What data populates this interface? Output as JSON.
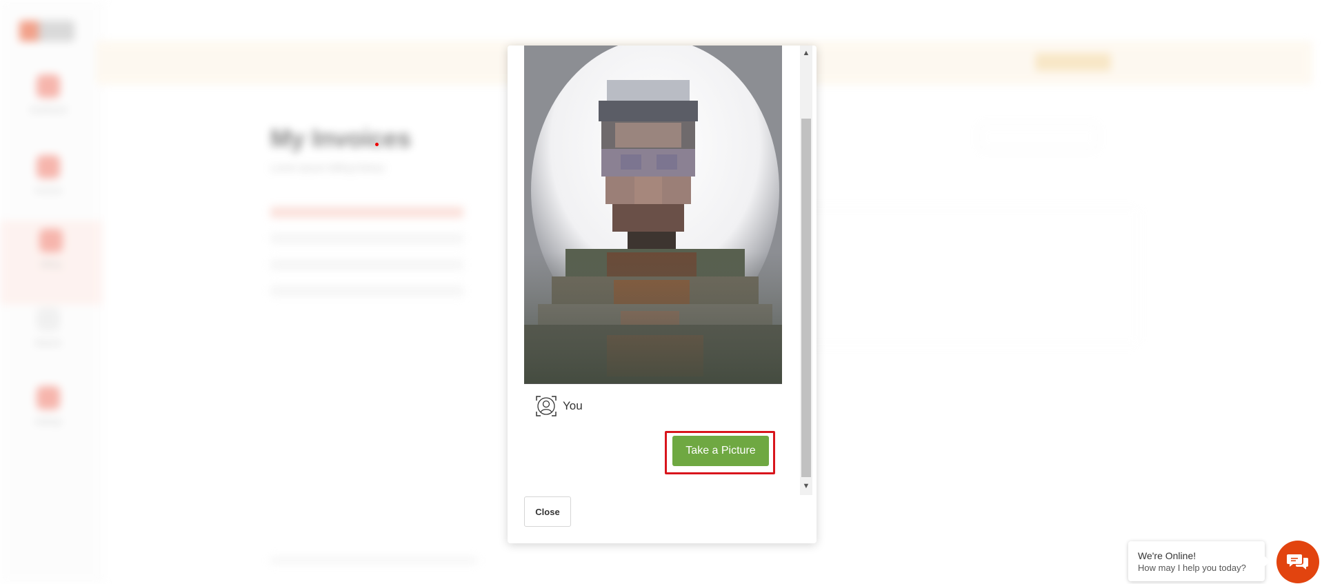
{
  "background": {
    "page_title": "My Invoices",
    "page_subtitle": "Lorem ipsum billing history",
    "nav_items": [
      "Dashboard",
      "Invoices",
      "Billing",
      "Reports",
      "Settings"
    ]
  },
  "modal": {
    "you_label": "You",
    "take_picture_label": "Take a Picture",
    "close_label": "Close",
    "accent_button_color": "#6fa842",
    "highlight_color": "#d8151c"
  },
  "chat": {
    "title": "We're Online!",
    "subtitle": "How may I help you today?",
    "launcher_color": "#e2440f"
  }
}
